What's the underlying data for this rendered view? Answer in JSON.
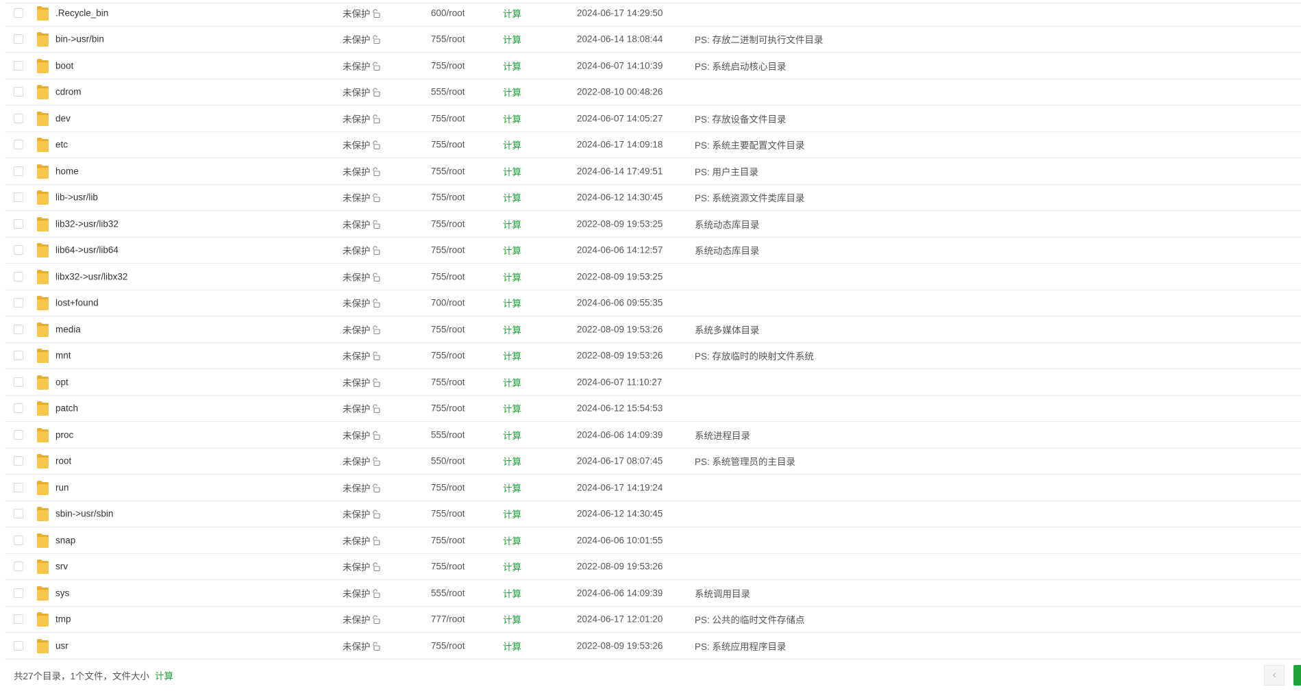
{
  "colors": {
    "accent": "#20a53a",
    "folder": "#f6c74a",
    "border": "#ececec"
  },
  "rows": [
    {
      "name": ".Recycle_bin",
      "protect": "未保护",
      "perm": "600/root",
      "size": "计算",
      "mtime": "2024-06-17 14:29:50",
      "remark": ""
    },
    {
      "name": "bin->usr/bin",
      "protect": "未保护",
      "perm": "755/root",
      "size": "计算",
      "mtime": "2024-06-14 18:08:44",
      "remark": "PS: 存放二进制可执行文件目录"
    },
    {
      "name": "boot",
      "protect": "未保护",
      "perm": "755/root",
      "size": "计算",
      "mtime": "2024-06-07 14:10:39",
      "remark": "PS: 系统启动核心目录"
    },
    {
      "name": "cdrom",
      "protect": "未保护",
      "perm": "555/root",
      "size": "计算",
      "mtime": "2022-08-10 00:48:26",
      "remark": ""
    },
    {
      "name": "dev",
      "protect": "未保护",
      "perm": "755/root",
      "size": "计算",
      "mtime": "2024-06-07 14:05:27",
      "remark": "PS: 存放设备文件目录"
    },
    {
      "name": "etc",
      "protect": "未保护",
      "perm": "755/root",
      "size": "计算",
      "mtime": "2024-06-17 14:09:18",
      "remark": "PS: 系统主要配置文件目录"
    },
    {
      "name": "home",
      "protect": "未保护",
      "perm": "755/root",
      "size": "计算",
      "mtime": "2024-06-14 17:49:51",
      "remark": "PS: 用户主目录"
    },
    {
      "name": "lib->usr/lib",
      "protect": "未保护",
      "perm": "755/root",
      "size": "计算",
      "mtime": "2024-06-12 14:30:45",
      "remark": "PS: 系统资源文件类库目录"
    },
    {
      "name": "lib32->usr/lib32",
      "protect": "未保护",
      "perm": "755/root",
      "size": "计算",
      "mtime": "2022-08-09 19:53:25",
      "remark": "系统动态库目录"
    },
    {
      "name": "lib64->usr/lib64",
      "protect": "未保护",
      "perm": "755/root",
      "size": "计算",
      "mtime": "2024-06-06 14:12:57",
      "remark": "系统动态库目录"
    },
    {
      "name": "libx32->usr/libx32",
      "protect": "未保护",
      "perm": "755/root",
      "size": "计算",
      "mtime": "2022-08-09 19:53:25",
      "remark": ""
    },
    {
      "name": "lost+found",
      "protect": "未保护",
      "perm": "700/root",
      "size": "计算",
      "mtime": "2024-06-06 09:55:35",
      "remark": ""
    },
    {
      "name": "media",
      "protect": "未保护",
      "perm": "755/root",
      "size": "计算",
      "mtime": "2022-08-09 19:53:26",
      "remark": "系统多媒体目录"
    },
    {
      "name": "mnt",
      "protect": "未保护",
      "perm": "755/root",
      "size": "计算",
      "mtime": "2022-08-09 19:53:26",
      "remark": "PS: 存放临时的映射文件系统"
    },
    {
      "name": "opt",
      "protect": "未保护",
      "perm": "755/root",
      "size": "计算",
      "mtime": "2024-06-07 11:10:27",
      "remark": ""
    },
    {
      "name": "patch",
      "protect": "未保护",
      "perm": "755/root",
      "size": "计算",
      "mtime": "2024-06-12 15:54:53",
      "remark": ""
    },
    {
      "name": "proc",
      "protect": "未保护",
      "perm": "555/root",
      "size": "计算",
      "mtime": "2024-06-06 14:09:39",
      "remark": "系统进程目录"
    },
    {
      "name": "root",
      "protect": "未保护",
      "perm": "550/root",
      "size": "计算",
      "mtime": "2024-06-17 08:07:45",
      "remark": "PS: 系统管理员的主目录"
    },
    {
      "name": "run",
      "protect": "未保护",
      "perm": "755/root",
      "size": "计算",
      "mtime": "2024-06-17 14:19:24",
      "remark": ""
    },
    {
      "name": "sbin->usr/sbin",
      "protect": "未保护",
      "perm": "755/root",
      "size": "计算",
      "mtime": "2024-06-12 14:30:45",
      "remark": ""
    },
    {
      "name": "snap",
      "protect": "未保护",
      "perm": "755/root",
      "size": "计算",
      "mtime": "2024-06-06 10:01:55",
      "remark": ""
    },
    {
      "name": "srv",
      "protect": "未保护",
      "perm": "755/root",
      "size": "计算",
      "mtime": "2022-08-09 19:53:26",
      "remark": ""
    },
    {
      "name": "sys",
      "protect": "未保护",
      "perm": "555/root",
      "size": "计算",
      "mtime": "2024-06-06 14:09:39",
      "remark": "系统调用目录"
    },
    {
      "name": "tmp",
      "protect": "未保护",
      "perm": "777/root",
      "size": "计算",
      "mtime": "2024-06-17 12:01:20",
      "remark": "PS: 公共的临时文件存储点"
    },
    {
      "name": "usr",
      "protect": "未保护",
      "perm": "755/root",
      "size": "计算",
      "mtime": "2022-08-09 19:53:26",
      "remark": "PS: 系统应用程序目录"
    }
  ],
  "footer": {
    "summary": "共27个目录，1个文件，文件大小",
    "calc_label": "计算"
  },
  "pagination": {
    "prev_icon": "chevron-left-icon",
    "prev_label": "‹"
  }
}
